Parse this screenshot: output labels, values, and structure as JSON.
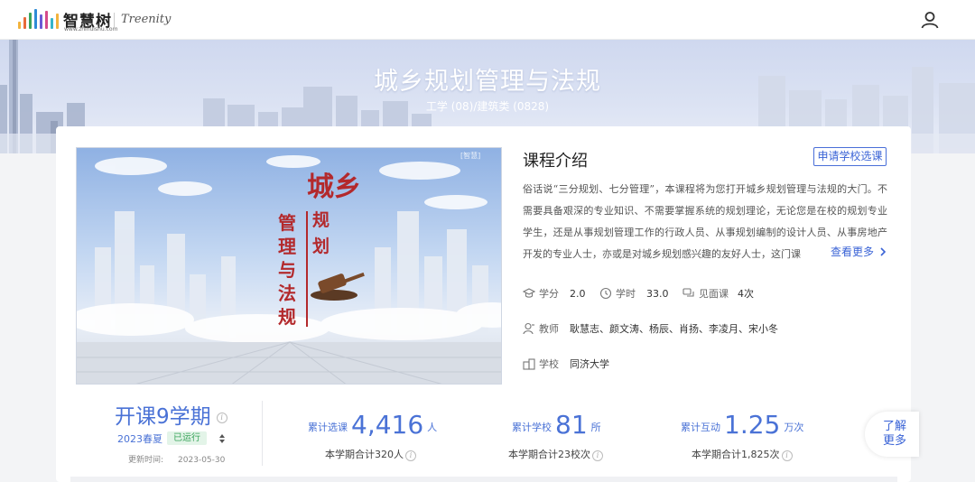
{
  "header": {
    "logo_cn": "智慧树",
    "logo_url": "www.zhihuishu.com",
    "logo_en": "Treenity"
  },
  "banner": {
    "title": "城乡规划管理与法规",
    "subtitle": "工学 (08)/建筑类 (0828)"
  },
  "cover": {
    "text_top": "城乡",
    "text_mid": "规划",
    "text_left": "管理与法规",
    "watermark": "[智慧]"
  },
  "intro": {
    "title": "课程介绍",
    "apply_label": "申请学校选课",
    "text": "俗话说“三分规划、七分管理”，本课程将为您打开城乡规划管理与法规的大门。不需要具备艰深的专业知识、不需要掌握系统的规划理论，无论您是在校的规划专业学生，还是从事规划管理工作的行政人员、从事规划编制的设计人员、从事房地产开发的专业人士，亦或是对城乡规划感兴趣的友好人士，这门课",
    "more_label": "查看更多",
    "credit_label": "学分",
    "credit_value": "2.0",
    "hours_label": "学时",
    "hours_value": "33.0",
    "meet_label": "见面课",
    "meet_value": "4次",
    "teacher_label": "教师",
    "teachers": "耿慧志、颜文涛、杨辰、肖扬、李凌月、宋小冬",
    "school_label": "学校",
    "school": "同济大学"
  },
  "semester": {
    "count_text": "开课9学期",
    "current": "2023春夏",
    "status": "已运行",
    "update_label": "更新时间:",
    "update_date": "2023-05-30"
  },
  "stats": [
    {
      "label": "累计选课",
      "value": "4,416",
      "unit": "人",
      "sub": "本学期合计320人"
    },
    {
      "label": "累计学校",
      "value": "81",
      "unit": "所",
      "sub": "本学期合计23校次"
    },
    {
      "label": "累计互动",
      "value": "1.25",
      "unit": "万次",
      "sub": "本学期合计1,825次"
    }
  ],
  "side": {
    "learn_more_1": "了解",
    "learn_more_2": "更多"
  },
  "colors": {
    "accent": "#4a72d6",
    "title_red": "#b3292c",
    "badge_green": "#3aa45b"
  }
}
